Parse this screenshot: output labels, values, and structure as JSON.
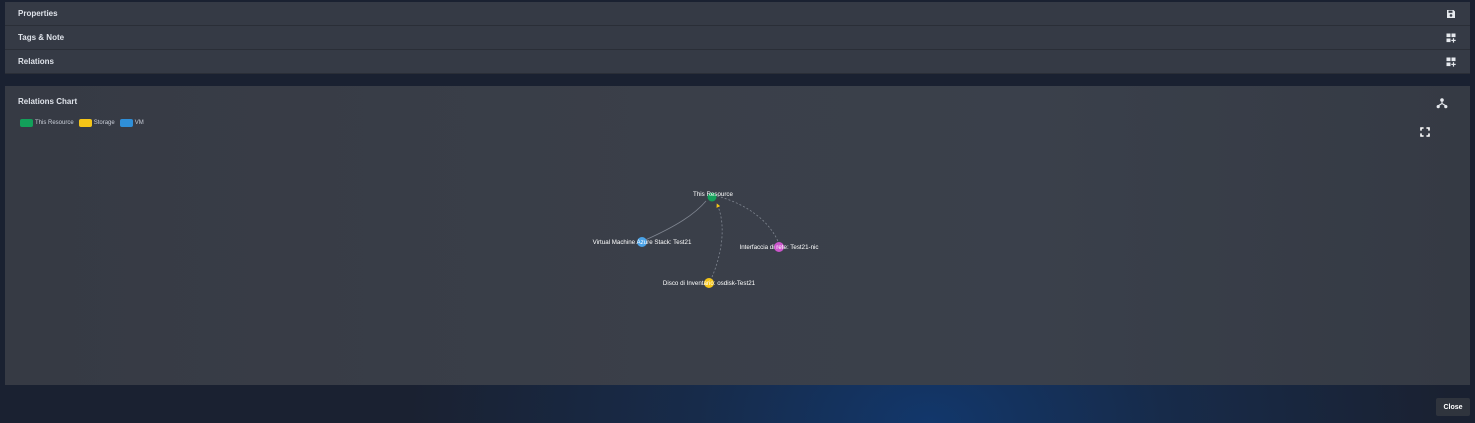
{
  "accordion": {
    "properties": "Properties",
    "tags_note": "Tags & Note",
    "relations": "Relations"
  },
  "relations_chart": {
    "title": "Relations Chart",
    "legend": [
      {
        "label": "This Resource",
        "color": "#13a05a"
      },
      {
        "label": "Storage",
        "color": "#f5c518"
      },
      {
        "label": "VM",
        "color": "#2f8fd8"
      }
    ],
    "nodes": [
      {
        "label": "This Resource",
        "color": "#13a05a"
      },
      {
        "label": "Virtual Machine Azure Stack: Test21",
        "color": "#4aa3e8"
      },
      {
        "label": "Interfaccia di rete: Test21-nic",
        "color": "#cc55cc"
      },
      {
        "label": "Disco di Inventario: osdisk-Test21",
        "color": "#f5c518"
      }
    ]
  },
  "footer": {
    "close_label": "Close"
  },
  "icons": {
    "properties": "save-icon",
    "tags_note": "widgets-add-icon",
    "relations": "widgets-add-icon",
    "chart": "hierarchy-icon",
    "fullscreen": "fullscreen-icon"
  }
}
